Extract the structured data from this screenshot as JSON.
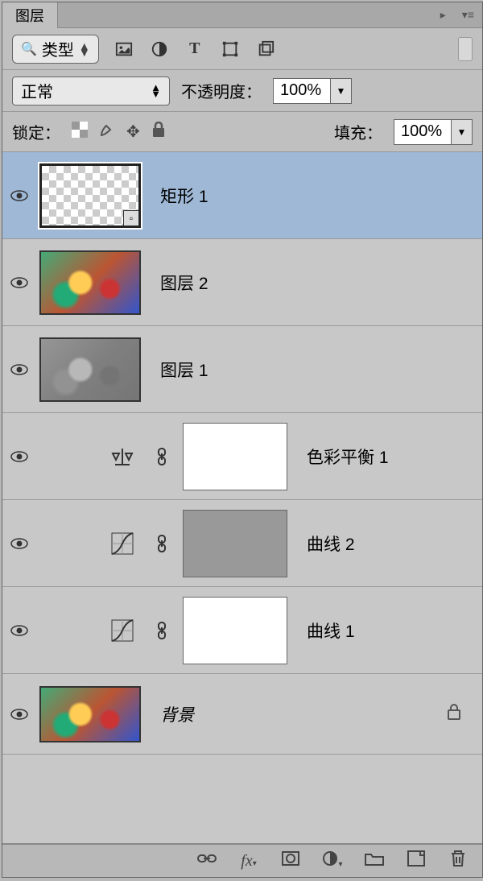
{
  "panel": {
    "title": "图层"
  },
  "filter": {
    "label": "类型"
  },
  "blend": {
    "mode": "正常",
    "opacity_label": "不透明度：",
    "opacity_value": "100%",
    "fill_label": "填充：",
    "fill_value": "100%"
  },
  "lock": {
    "label": "锁定："
  },
  "layers": [
    {
      "name": "矩形 1",
      "kind": "shape-checker",
      "selected": true
    },
    {
      "name": "图层 2",
      "kind": "image"
    },
    {
      "name": "图层 1",
      "kind": "image-emboss"
    },
    {
      "name": "色彩平衡 1",
      "kind": "adj-balance",
      "mask": "white"
    },
    {
      "name": "曲线 2",
      "kind": "adj-curves",
      "mask": "gray"
    },
    {
      "name": "曲线 1",
      "kind": "adj-curves",
      "mask": "white"
    },
    {
      "name": "背景",
      "kind": "bg-image",
      "locked": true
    }
  ]
}
